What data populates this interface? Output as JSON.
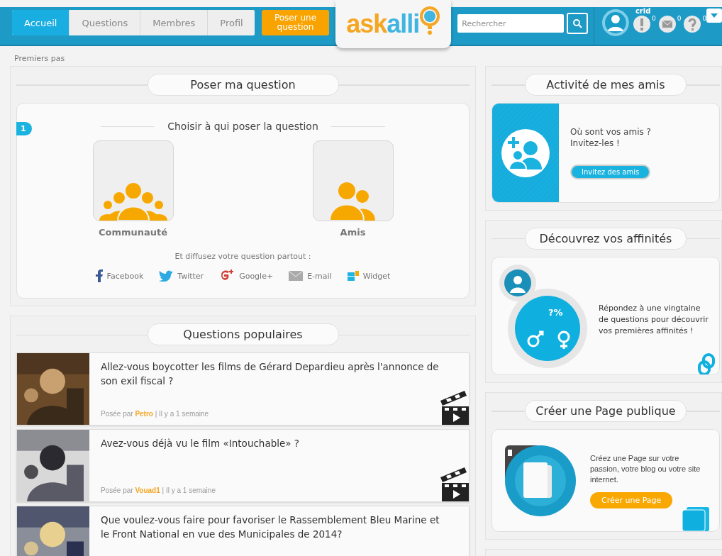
{
  "nav": {
    "tabs": [
      {
        "label": "Accueil",
        "selected": true
      },
      {
        "label": "Questions",
        "selected": false
      },
      {
        "label": "Membres",
        "selected": false
      },
      {
        "label": "Profil",
        "selected": false
      }
    ],
    "ask_button": "Poser une question",
    "logo": {
      "part_1": "ask",
      "part_2": "alli"
    },
    "search": {
      "placeholder": "Rechercher"
    },
    "user": {
      "name": "crid"
    },
    "counters": [
      {
        "kind": "alert",
        "count": "0"
      },
      {
        "kind": "mail",
        "count": "0"
      },
      {
        "kind": "question",
        "count": "0"
      }
    ]
  },
  "breadcrumb": "Premiers pas",
  "ask_panel": {
    "title": "Poser ma question",
    "step": "1",
    "step_title": "Choisir à qui poser la question",
    "targets": [
      {
        "kind": "community",
        "label": "Communauté"
      },
      {
        "kind": "friends",
        "label": "Amis"
      }
    ],
    "share_label": "Et diffusez votre question partout :",
    "share_links": [
      {
        "kind": "facebook",
        "label": "Facebook"
      },
      {
        "kind": "twitter",
        "label": "Twitter"
      },
      {
        "kind": "google",
        "label": "Google+"
      },
      {
        "kind": "email",
        "label": "E-mail"
      },
      {
        "kind": "widget",
        "label": "Widget"
      }
    ]
  },
  "popular": {
    "title": "Questions populaires",
    "questions": [
      {
        "text": "Allez-vous boycotter les films de Gérard Depardieu après l'annonce de son exil fiscal ?",
        "by": "Posée par",
        "author": "Petro",
        "time": "| Il y a 1 semaine",
        "kind": "cinema"
      },
      {
        "text": "Avez-vous déjà vu le film «Intouchable» ?",
        "by": "Posée par",
        "author": "Vouad1",
        "time": "| Il y a 1 semaine",
        "kind": "cinema"
      },
      {
        "text": "Que voulez-vous faire pour favoriser le Rassemblement Bleu Marine et le Front National en vue des Municipales de 2014?"
      }
    ]
  },
  "friends_panel": {
    "title": "Activité de mes amis",
    "lines": [
      "Où sont vos amis ?",
      "Invitez-les !"
    ],
    "button": "Invitez des amis"
  },
  "affinities_panel": {
    "title": "Découvrez vos affinités",
    "badge": "?%",
    "text": "Répondez à une vingtaine de questions pour découvrir vos premières affinités !"
  },
  "page_panel": {
    "title": "Créer une Page publique",
    "text": "Créez une Page sur votre passion, votre blog ou votre site internet.",
    "button": "Créer une Page"
  }
}
